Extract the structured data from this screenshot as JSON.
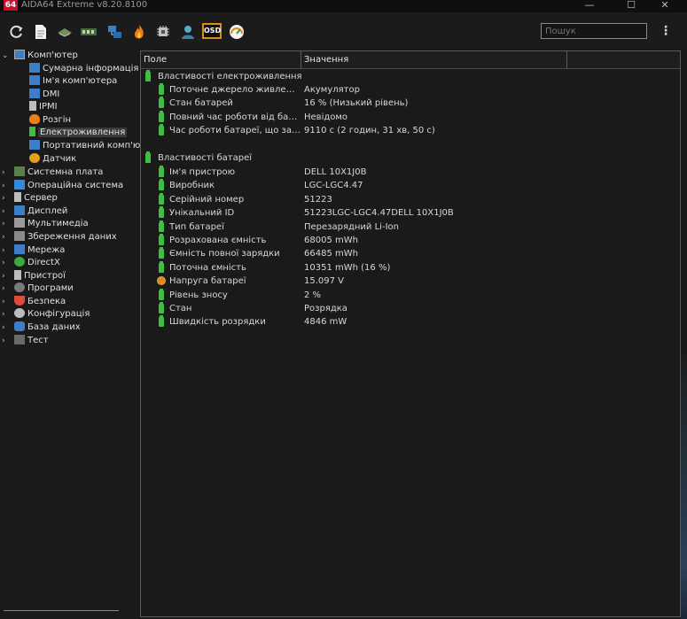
{
  "window": {
    "logo": "64",
    "title": "AIDA64 Extreme v8.20.8100",
    "minimize": "—",
    "maximize": "☐",
    "close": "✕"
  },
  "toolbar": {
    "icons": [
      "refresh-icon",
      "report-icon",
      "motherboard-icon",
      "memory-icon",
      "network-icon",
      "flame-icon",
      "cpu-icon",
      "user-icon",
      "osd-icon",
      "speedometer-icon"
    ],
    "osd_label": "OSD",
    "search_placeholder": "Пошук",
    "menu": "⋮"
  },
  "tree": {
    "root": "Комп'ютер",
    "children": [
      "Сумарна інформація",
      "Ім'я комп'ютера",
      "DMI",
      "IPMI",
      "Розгін",
      "Електроживлення",
      "Портативний комп'юте",
      "Датчик"
    ],
    "sections": [
      "Системна плата",
      "Операційна система",
      "Сервер",
      "Дисплей",
      "Мультимедіа",
      "Збереження даних",
      "Мережа",
      "DirectX",
      "Пристрої",
      "Програми",
      "Безпека",
      "Конфігурація",
      "База даних",
      "Тест"
    ]
  },
  "list": {
    "col_field": "Поле",
    "col_value": "Значення",
    "group1": "Властивості електроживлення",
    "rows1": [
      {
        "field": "Поточне джерело живлення",
        "value": "Акумулятор"
      },
      {
        "field": "Стан батарей",
        "value": "16 % (Низький рівень)"
      },
      {
        "field": "Повний час роботи від батареї",
        "value": "Невідомо"
      },
      {
        "field": "Час роботи батареї, що залиш...",
        "value": "9110 с (2 годин, 31 хв, 50 с)"
      }
    ],
    "group2": "Властивості батареї",
    "rows2": [
      {
        "field": "Ім'я пристрою",
        "value": "DELL 10X1J0B"
      },
      {
        "field": "Виробник",
        "value": "LGC-LGC4.47"
      },
      {
        "field": "Серійний номер",
        "value": "51223"
      },
      {
        "field": "Унікальний ID",
        "value": "51223LGC-LGC4.47DELL 10X1J0B"
      },
      {
        "field": "Тип батареї",
        "value": "Перезарядний Li-Ion"
      },
      {
        "field": "Розрахована ємність",
        "value": "68005 mWh"
      },
      {
        "field": "Ємність повної зарядки",
        "value": "66485 mWh"
      },
      {
        "field": "Поточна ємність",
        "value": "10351 mWh  (16 %)"
      },
      {
        "field": "Напруга батареї",
        "value": "15.097 V"
      },
      {
        "field": "Рівень зносу",
        "value": "2 %"
      },
      {
        "field": "Стан",
        "value": "Розрядка"
      },
      {
        "field": "Швидкість розрядки",
        "value": "4846 mW"
      }
    ]
  }
}
